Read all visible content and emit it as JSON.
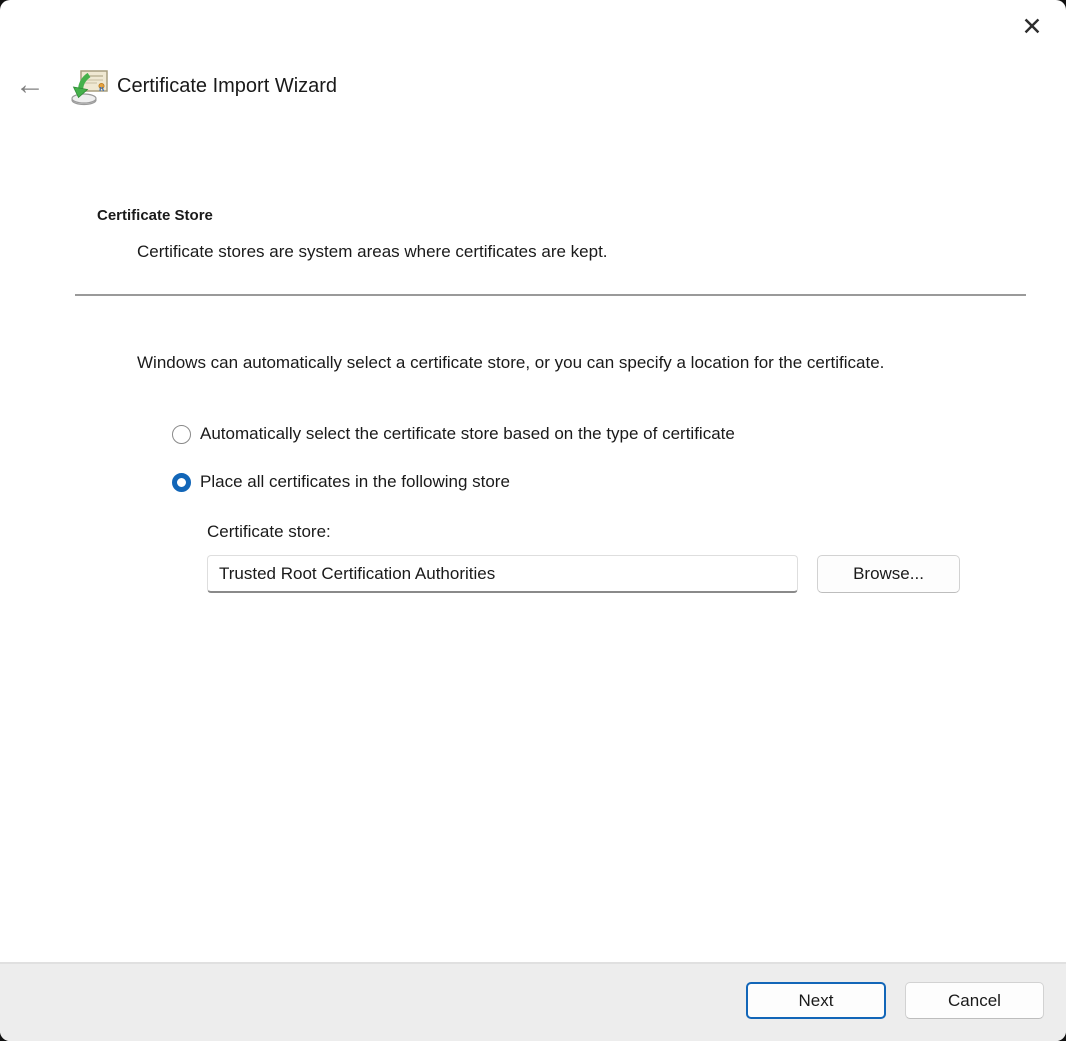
{
  "window": {
    "title": "Certificate Import Wizard"
  },
  "icons": {
    "close": "✕",
    "back": "←",
    "wizard": "certificate-import-icon"
  },
  "content": {
    "heading": "Certificate Store",
    "subheading": "Certificate stores are system areas where certificates are kept.",
    "description": "Windows can automatically select a certificate store, or you can specify a location for the certificate.",
    "radio_options": [
      {
        "label": "Automatically select the certificate store based on the type of certificate",
        "selected": false
      },
      {
        "label": "Place all certificates in the following store",
        "selected": true
      }
    ],
    "store_field": {
      "label": "Certificate store:",
      "value": "Trusted Root Certification Authorities"
    },
    "browse_button": "Browse..."
  },
  "footer": {
    "next_button": "Next",
    "cancel_button": "Cancel"
  },
  "colors": {
    "accent": "#1266b8",
    "footer_bg": "#ededed",
    "divider": "#9a9a9a",
    "window_bg": "#ffffff"
  }
}
